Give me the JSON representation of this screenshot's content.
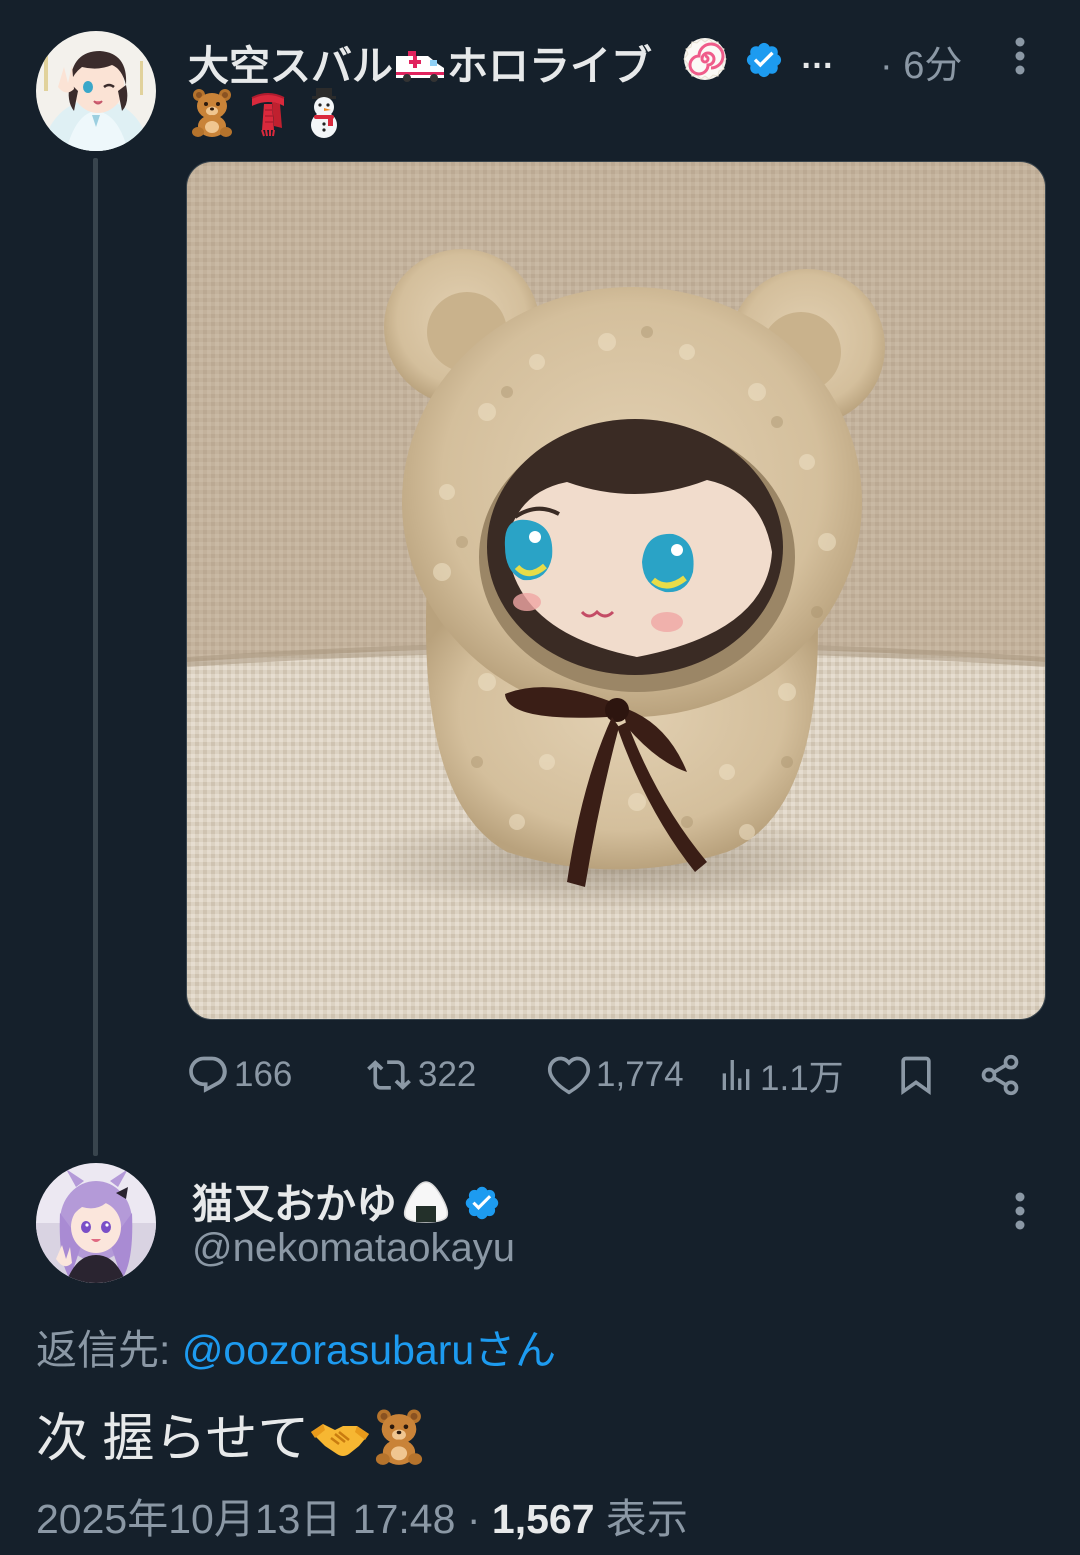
{
  "tweet": {
    "author": {
      "display_name": "大空スバル",
      "display_name_suffix": "ホロライブ",
      "avatar_icon": "subaru-avatar",
      "verified_color": "#1d9bf0"
    },
    "name_overflow": "…",
    "time_separator": "·",
    "time": "6分",
    "emoji_line": [
      "teddy-bear-emoji",
      "scarf-emoji",
      "snowman-emoji"
    ],
    "media": {
      "subject": "plush-doll-photo"
    },
    "stats": {
      "replies": "166",
      "retweets": "322",
      "likes": "1,774",
      "views": "1.1万"
    }
  },
  "reply": {
    "author": {
      "display_name": "猫又おかゆ",
      "handle": "@nekomataokayu",
      "avatar_icon": "okayu-avatar"
    },
    "reply_to_label": "返信先:",
    "reply_to_handle": "@oozorasubaru",
    "reply_to_suffix": "さん",
    "text": "次 握らせて",
    "text_emojis": [
      "handshake-emoji",
      "teddy-bear-emoji"
    ],
    "date": "2025年10月13日 17:48",
    "meta_separator": "·",
    "views_count": "1,567",
    "views_label": "表示"
  },
  "colors": {
    "background": "#15202b",
    "text_primary": "#e7e9ea",
    "text_secondary": "#8b98a5",
    "link": "#1d9bf0",
    "divider": "#38444d"
  }
}
